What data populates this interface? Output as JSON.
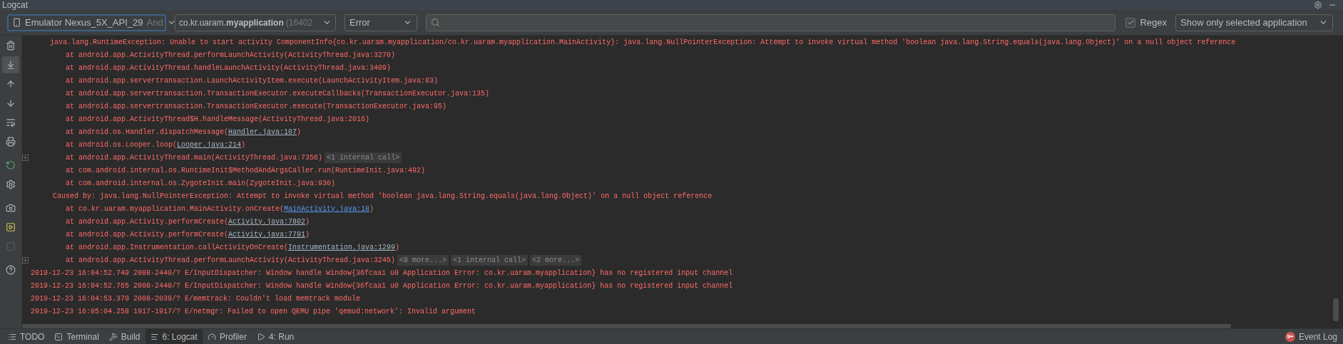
{
  "window": {
    "title": "Logcat"
  },
  "toolbar": {
    "device": {
      "name": "Emulator Nexus_5X_API_29",
      "suffix": "And"
    },
    "process": {
      "name": "co.kr.uaram.**myapplication**",
      "pid": "(16402"
    },
    "level": "Error",
    "regex": {
      "label": "Regex",
      "checked": true
    },
    "filter": "Show only selected application"
  },
  "gutter": [
    {
      "kind": "trash",
      "selected": false,
      "disabled": false
    },
    {
      "kind": "scroll-end",
      "selected": true,
      "disabled": false
    },
    {
      "kind": "up",
      "selected": false,
      "disabled": false
    },
    {
      "kind": "down",
      "selected": false,
      "disabled": false
    },
    {
      "kind": "wrap",
      "selected": false,
      "disabled": false
    },
    {
      "kind": "print",
      "selected": false,
      "disabled": false
    },
    {
      "kind": "restart",
      "selected": false,
      "disabled": false
    },
    {
      "kind": "settings",
      "selected": false,
      "disabled": false
    },
    {
      "kind": "camera",
      "selected": false,
      "disabled": false
    },
    {
      "kind": "record",
      "selected": false,
      "disabled": false
    },
    {
      "kind": "stop",
      "selected": false,
      "disabled": true
    },
    {
      "kind": "help",
      "selected": false,
      "disabled": false
    }
  ],
  "log": [
    {
      "kind": "exception",
      "text": "java.lang.RuntimeException: Unable to start activity ComponentInfo{co.kr.uaram.myapplication/co.kr.uaram.myapplication.MainActivity}: java.lang.NullPointerException: Attempt to invoke virtual method 'boolean java.lang.String.equals(java.lang.Object)' on a null object reference"
    },
    {
      "kind": "frame",
      "text": "at android.app.ActivityThread.performLaunchActivity(ActivityThread.java:3270)"
    },
    {
      "kind": "frame",
      "text": "at android.app.ActivityThread.handleLaunchActivity(ActivityThread.java:3409)"
    },
    {
      "kind": "frame",
      "text": "at android.app.servertransaction.LaunchActivityItem.execute(LaunchActivityItem.java:83)"
    },
    {
      "kind": "frame",
      "text": "at android.app.servertransaction.TransactionExecutor.executeCallbacks(TransactionExecutor.java:135)"
    },
    {
      "kind": "frame",
      "text": "at android.app.servertransaction.TransactionExecutor.execute(TransactionExecutor.java:95)"
    },
    {
      "kind": "frame",
      "text": "at android.app.ActivityThread$H.handleMessage(ActivityThread.java:2016)"
    },
    {
      "kind": "frame",
      "text": "at android.os.Handler.dispatchMessage(",
      "link": {
        "text": "Handler.java:107",
        "kind": "library"
      },
      "suffix": ")"
    },
    {
      "kind": "frame",
      "text": "at android.os.Looper.loop(",
      "link": {
        "text": "Looper.java:214",
        "kind": "library"
      },
      "suffix": ")"
    },
    {
      "kind": "frame",
      "text": "at android.app.ActivityThread.main(ActivityThread.java:7356)",
      "folds": [
        "<1 internal call>"
      ]
    },
    {
      "kind": "frame",
      "text": "at com.android.internal.os.RuntimeInit$MethodAndArgsCaller.run(RuntimeInit.java:492)"
    },
    {
      "kind": "frame",
      "text": "at com.android.internal.os.ZygoteInit.main(ZygoteInit.java:930)"
    },
    {
      "kind": "caused",
      "text": "Caused by: java.lang.NullPointerException: Attempt to invoke virtual method 'boolean java.lang.String.equals(java.lang.Object)' on a null object reference"
    },
    {
      "kind": "frame",
      "text": "at co.kr.uaram.myapplication.MainActivity.onCreate(",
      "link": {
        "text": "MainActivity.java:18",
        "kind": "project"
      },
      "suffix": ")"
    },
    {
      "kind": "frame",
      "text": "at android.app.Activity.performCreate(",
      "link": {
        "text": "Activity.java:7802",
        "kind": "library"
      },
      "suffix": ")"
    },
    {
      "kind": "frame",
      "text": "at android.app.Activity.performCreate(",
      "link": {
        "text": "Activity.java:7791",
        "kind": "library"
      },
      "suffix": ")"
    },
    {
      "kind": "frame",
      "text": "at android.app.Instrumentation.callActivityOnCreate(",
      "link": {
        "text": "Instrumentation.java:1299",
        "kind": "library"
      },
      "suffix": ")"
    },
    {
      "kind": "frame",
      "text": "at android.app.ActivityThread.performLaunchActivity(ActivityThread.java:3245)",
      "folds": [
        "<8 more...>",
        "<1 internal call>",
        "<2 more...>"
      ]
    },
    {
      "kind": "entry",
      "text": "2019-12-23 16:04:52.749 2008-2440/? E/InputDispatcher: Window handle Window{36fcaa1 u0 Application Error: co.kr.uaram.myapplication} has no registered input channel"
    },
    {
      "kind": "entry",
      "text": "2019-12-23 16:04:52.765 2008-2440/? E/InputDispatcher: Window handle Window{36fcaa1 u0 Application Error: co.kr.uaram.myapplication} has no registered input channel"
    },
    {
      "kind": "entry",
      "text": "2019-12-23 16:04:53.370 2008-2039/? E/memtrack: Couldn't load memtrack module"
    },
    {
      "kind": "entry",
      "text": "2019-12-23 16:05:04.258 1917-1917/? E/netmgr: Failed to open QEMU pipe 'qemud:network': Invalid argument"
    }
  ],
  "status_bar": {
    "tabs": [
      {
        "kind": "todo",
        "label": "TODO",
        "selected": false
      },
      {
        "kind": "terminal",
        "label": "Terminal",
        "selected": false
      },
      {
        "kind": "build",
        "label": "Build",
        "selected": false
      },
      {
        "kind": "logcat",
        "label": "6: Logcat",
        "selected": true
      },
      {
        "kind": "profiler",
        "label": "Profiler",
        "selected": false
      },
      {
        "kind": "run",
        "label": "4: Run",
        "selected": false
      }
    ],
    "event_log": {
      "label": "Event Log",
      "badge": "9+"
    }
  }
}
